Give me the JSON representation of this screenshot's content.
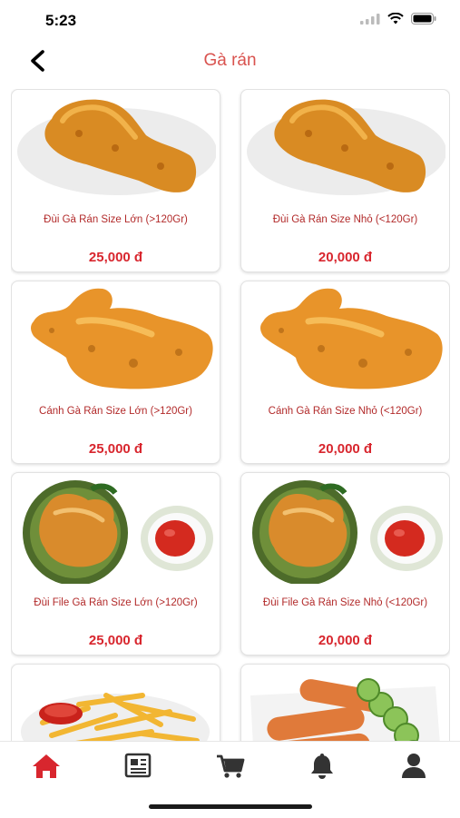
{
  "status_bar": {
    "time": "5:23"
  },
  "header": {
    "title": "Gà rán"
  },
  "products": [
    {
      "name": "Đùi Gà Rán Size Lớn (>120Gr)",
      "price": "25,000 đ",
      "image": "fried-drumstick"
    },
    {
      "name": "Đùi Gà Rán Size Nhỏ (<120Gr)",
      "price": "20,000 đ",
      "image": "fried-drumstick"
    },
    {
      "name": "Cánh Gà Rán Size Lớn (>120Gr)",
      "price": "25,000 đ",
      "image": "fried-wing"
    },
    {
      "name": "Cánh Gà Rán Size Nhỏ (<120Gr)",
      "price": "20,000 đ",
      "image": "fried-wing"
    },
    {
      "name": "Đùi File Gà Rán Size Lớn (>120Gr)",
      "price": "25,000 đ",
      "image": "fried-fillet-with-ketchup"
    },
    {
      "name": "Đùi File Gà Rán Size Nhỏ (<120Gr)",
      "price": "20,000 đ",
      "image": "fried-fillet-with-ketchup"
    },
    {
      "name": "",
      "price": "",
      "image": "french-fries"
    },
    {
      "name": "",
      "price": "",
      "image": "sausages-with-cucumber"
    }
  ],
  "tabbar": {
    "items": [
      {
        "icon": "home-icon",
        "active": true
      },
      {
        "icon": "news-icon",
        "active": false
      },
      {
        "icon": "cart-icon",
        "active": false
      },
      {
        "icon": "bell-icon",
        "active": false
      },
      {
        "icon": "user-icon",
        "active": false
      }
    ]
  },
  "colors": {
    "accent": "#d8262e",
    "title": "#d9534f",
    "name": "#b22a2a",
    "tab_active": "#d8262e",
    "tab_inactive": "#333333"
  }
}
